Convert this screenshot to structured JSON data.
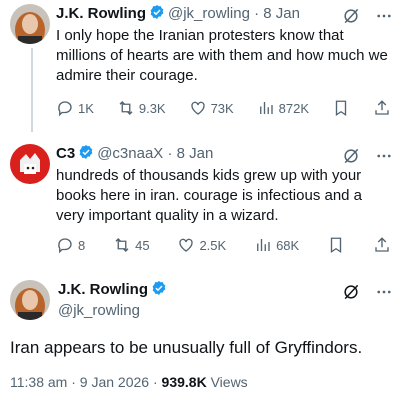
{
  "tweet1": {
    "name": "J.K. Rowling",
    "handle": "@jk_rowling",
    "date": "8 Jan",
    "text": "I only hope the Iranian protesters know that millions of hearts are with them and how much we admire their courage.",
    "replies": "1K",
    "retweets": "9.3K",
    "likes": "73K",
    "views": "872K"
  },
  "tweet2": {
    "name": "C3",
    "handle": "@c3naaX",
    "date": "8 Jan",
    "text": "hundreds of thousands kids grew up with your books here in iran. courage is infectious and a very important quality in a wizard.",
    "replies": "8",
    "retweets": "45",
    "likes": "2.5K",
    "views": "68K"
  },
  "main": {
    "name": "J.K. Rowling",
    "handle": "@jk_rowling",
    "text": "Iran appears to be unusually full of Gryffindors.",
    "time": "11:38 am",
    "date": "9 Jan 2026",
    "views_count": "939.8K",
    "views_label": "Views"
  },
  "colors": {
    "verified": "#1d9bf0",
    "text": "#0f1419",
    "muted": "#536471"
  },
  "icons": [
    "grok-icon",
    "more-icon",
    "reply-icon",
    "retweet-icon",
    "like-icon",
    "views-icon",
    "bookmark-icon",
    "share-icon",
    "verified-icon"
  ]
}
